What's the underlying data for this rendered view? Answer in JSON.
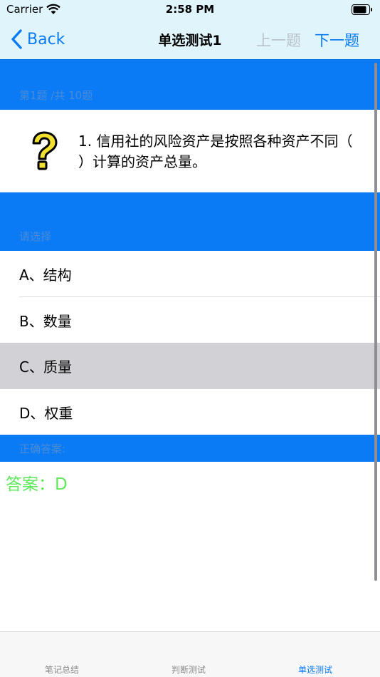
{
  "status_bar": {
    "carrier": "Carrier",
    "time": "2:58 PM"
  },
  "nav": {
    "back_label": "Back",
    "title": "单选测试1",
    "prev_label": "上一题",
    "next_label": "下一题"
  },
  "question": {
    "header": "第1题 /共 10题",
    "text": "1.  信用社的风险资产是按照各种资产不同（   ）计算的资产总量。",
    "icon": "question-mark-icon"
  },
  "options_header": "请选择",
  "options": [
    {
      "label": "A、结构",
      "selected": false
    },
    {
      "label": "B、数量",
      "selected": false
    },
    {
      "label": "C、质量",
      "selected": true
    },
    {
      "label": "D、权重",
      "selected": false
    }
  ],
  "answer_header": "正确答案:",
  "answer_text": "答案：D",
  "tabs": [
    {
      "label": "笔记总结",
      "active": false
    },
    {
      "label": "判断测试",
      "active": false
    },
    {
      "label": "单选测试",
      "active": true
    }
  ],
  "colors": {
    "accent": "#0a7bf5",
    "nav_background": "#e0f5fb",
    "selected_row": "#d1d1d6",
    "answer_text": "#5ee85a",
    "disabled_text": "#b9c2c8"
  }
}
